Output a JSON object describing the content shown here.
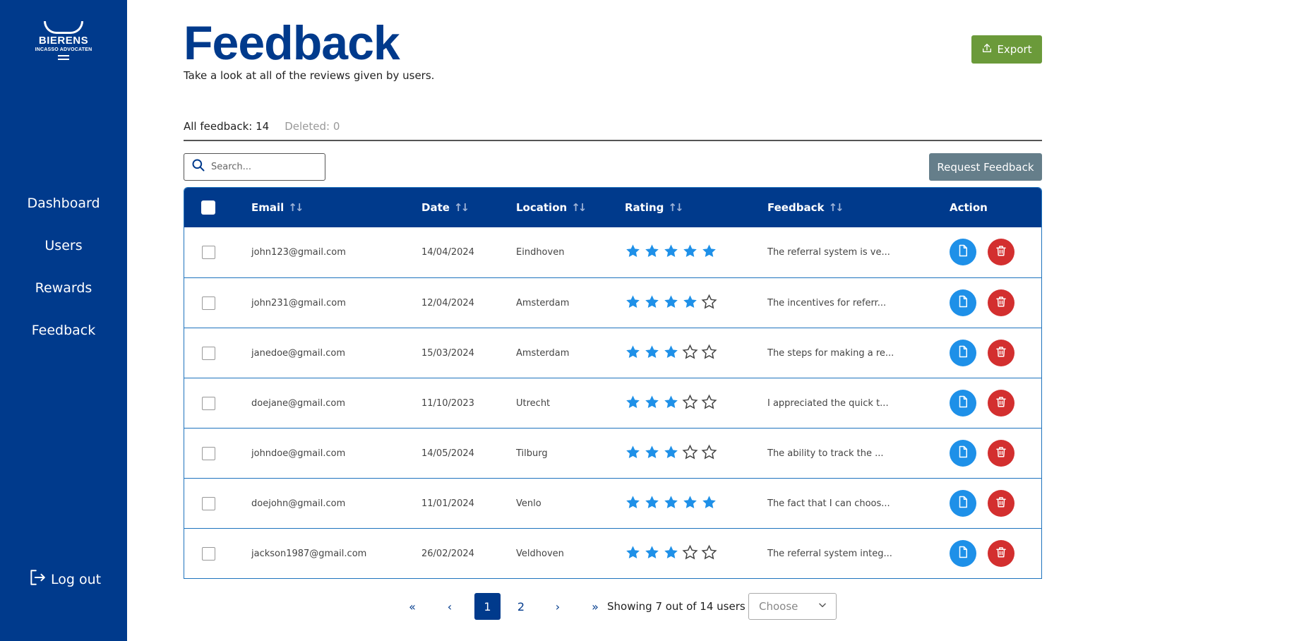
{
  "brand": {
    "name": "BIERENS",
    "tagline": "INCASSO ADVOCATEN"
  },
  "colors": {
    "sidebar": "#003A8C",
    "export": "#6B9A3A",
    "request": "#657E8A",
    "view": "#1E90E8",
    "delete": "#D32F2F",
    "star": "#1E90E8"
  },
  "sidebar": {
    "items": [
      {
        "label": "Dashboard"
      },
      {
        "label": "Users"
      },
      {
        "label": "Rewards"
      },
      {
        "label": "Feedback"
      }
    ],
    "logout": "Log out"
  },
  "header": {
    "title": "Feedback",
    "subtitle": "Take a look at all of the reviews given by users.",
    "export_label": "Export"
  },
  "tabs": [
    {
      "label": "All feedback: 14"
    },
    {
      "label": "Deleted: 0"
    }
  ],
  "search": {
    "placeholder": "Search..."
  },
  "request_label": "Request Feedback",
  "table": {
    "columns": [
      "Email",
      "Date",
      "Location",
      "Rating",
      "Feedback",
      "Action"
    ],
    "rows": [
      {
        "email": "john123@gmail.com",
        "date": "14/04/2024",
        "location": "Eindhoven",
        "rating": 5,
        "feedback": "The referral system is ve..."
      },
      {
        "email": "john231@gmail.com",
        "date": "12/04/2024",
        "location": "Amsterdam",
        "rating": 4,
        "feedback": "The incentives for referr..."
      },
      {
        "email": "janedoe@gmail.com",
        "date": "15/03/2024",
        "location": "Amsterdam",
        "rating": 3,
        "feedback": "The steps for making a re..."
      },
      {
        "email": "doejane@gmail.com",
        "date": "11/10/2023",
        "location": "Utrecht",
        "rating": 3,
        "feedback": "I appreciated the quick t..."
      },
      {
        "email": "johndoe@gmail.com",
        "date": "14/05/2024",
        "location": "Tilburg",
        "rating": 3,
        "feedback": "The ability to track the ..."
      },
      {
        "email": "doejohn@gmail.com",
        "date": "11/01/2024",
        "location": "Venlo",
        "rating": 5,
        "feedback": "The fact that I can choos..."
      },
      {
        "email": "jackson1987@gmail.com",
        "date": "26/02/2024",
        "location": "Veldhoven",
        "rating": 3,
        "feedback": "The referral system integ..."
      }
    ]
  },
  "pagination": {
    "first": "«",
    "prev": "‹",
    "pages": [
      "1",
      "2"
    ],
    "current": "1",
    "next": "›",
    "last": "»",
    "showing": "Showing 7 out of 14 users",
    "select_placeholder": "Choose"
  }
}
